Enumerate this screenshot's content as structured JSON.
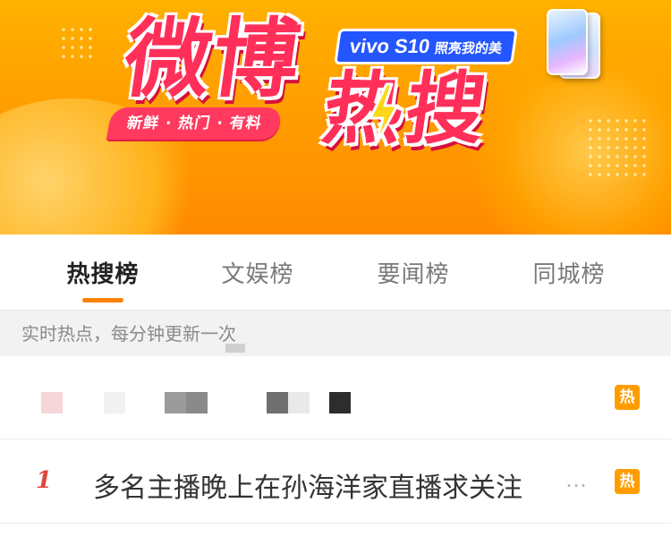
{
  "banner": {
    "title_line1": "微博",
    "title_line2": "热搜",
    "tagline": "新鲜 · 热门 · 有料",
    "ad_brand": "vivo S10",
    "ad_slogan": "照亮我的美",
    "colors": {
      "background": "#ffa000",
      "title": "#ff2f5a",
      "ad_badge": "#2456ff"
    }
  },
  "tabs": [
    {
      "label": "热搜榜",
      "active": true
    },
    {
      "label": "文娱榜",
      "active": false
    },
    {
      "label": "要闻榜",
      "active": false
    },
    {
      "label": "同城榜",
      "active": false
    }
  ],
  "subheader": "实时热点，每分钟更新一次",
  "list": [
    {
      "rank": "",
      "title": "",
      "badge": "热",
      "obscured": true
    },
    {
      "rank": "1",
      "title": "多名主播晚上在孙海洋家直播求关注",
      "ellipsis": "…",
      "badge": "热"
    }
  ],
  "colors": {
    "accent": "#ff8200",
    "hot_badge": "#ff9d00",
    "rank": "#e0463a"
  },
  "icons": {
    "hot": "hot-badge-icon",
    "bolt": "lightning-icon"
  }
}
